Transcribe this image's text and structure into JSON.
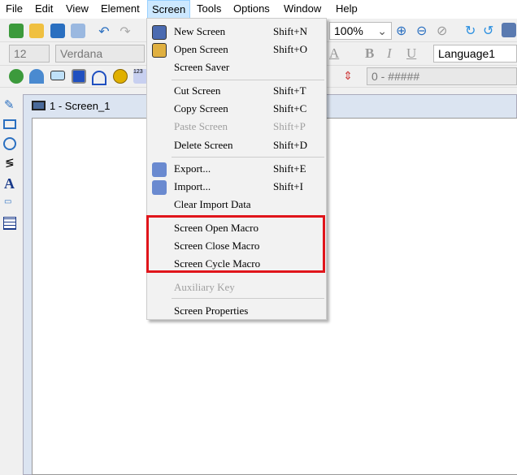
{
  "menubar": [
    "File",
    "Edit",
    "View",
    "Element",
    "Screen",
    "Tools",
    "Options",
    "Window",
    "Help"
  ],
  "toolbar": {
    "zoom": "100%",
    "font_size": "12",
    "font_name": "Verdana",
    "language": "Language1",
    "format": "0 - #####"
  },
  "document": {
    "title": "1 - Screen_1"
  },
  "screen_menu": {
    "items": [
      {
        "label": "New Screen",
        "shortcut": "Shift+N",
        "icon": "new-screen-icon",
        "enabled": true
      },
      {
        "label": "Open Screen",
        "shortcut": "Shift+O",
        "icon": "open-screen-icon",
        "enabled": true
      },
      {
        "label": "Screen Saver",
        "shortcut": "",
        "enabled": true
      },
      {
        "label": "Cut Screen",
        "shortcut": "Shift+T",
        "enabled": true
      },
      {
        "label": "Copy Screen",
        "shortcut": "Shift+C",
        "enabled": true
      },
      {
        "label": "Paste Screen",
        "shortcut": "Shift+P",
        "enabled": false
      },
      {
        "label": "Delete Screen",
        "shortcut": "Shift+D",
        "enabled": true
      },
      {
        "label": "Export...",
        "shortcut": "Shift+E",
        "icon": "export-icon",
        "enabled": true
      },
      {
        "label": "Import...",
        "shortcut": "Shift+I",
        "icon": "import-icon",
        "enabled": true
      },
      {
        "label": "Clear Import Data",
        "shortcut": "",
        "enabled": true
      },
      {
        "label": "Screen Open Macro",
        "shortcut": "",
        "enabled": true
      },
      {
        "label": "Screen Close Macro",
        "shortcut": "",
        "enabled": true
      },
      {
        "label": "Screen Cycle Macro",
        "shortcut": "",
        "enabled": true
      },
      {
        "label": "Auxiliary Key",
        "shortcut": "",
        "enabled": false
      },
      {
        "label": "Screen Properties",
        "shortcut": "",
        "enabled": true
      }
    ]
  },
  "colors": {
    "highlight_box": "#e0151b",
    "menu_active": "#cce8ff"
  }
}
